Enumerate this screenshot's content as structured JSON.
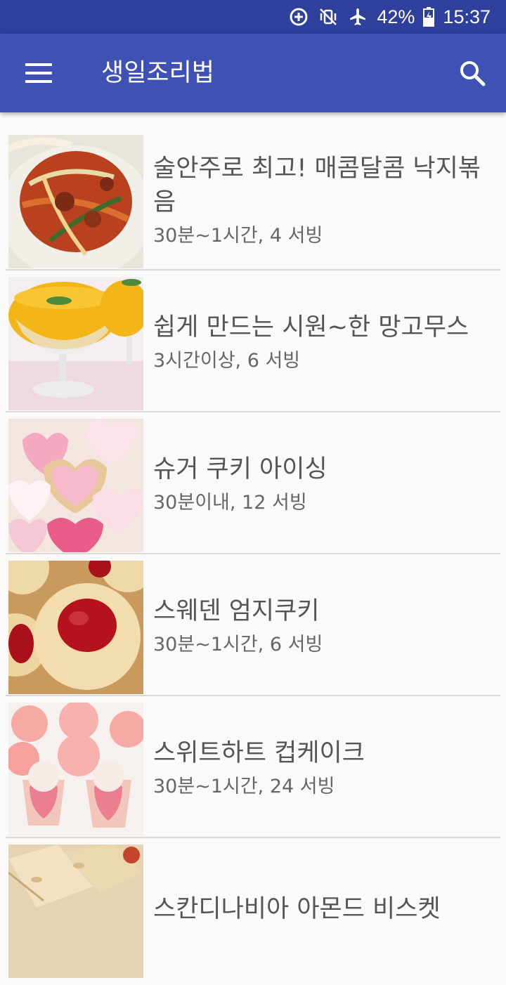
{
  "status_bar": {
    "icons": [
      "data-saver-icon",
      "vibrate-mute-icon",
      "airplane-icon",
      "battery-icon"
    ],
    "battery_percent": "42%",
    "time": "15:37"
  },
  "app_bar": {
    "title": "생일조리법",
    "menu_icon": "menu-icon",
    "search_icon": "search-icon",
    "color": "#3f51b5"
  },
  "recipes": [
    {
      "name": "술안주로 최고! 매콤달콤 낙지볶음",
      "meta": "30분~1시간, 4 서빙",
      "image": "spicy-octopus-stir-fry"
    },
    {
      "name": "쉽게 만드는 시원~한 망고무스",
      "meta": "3시간이상, 6 서빙",
      "image": "mango-mousse"
    },
    {
      "name": "슈거 쿠키 아이싱",
      "meta": "30분이내, 12 서빙",
      "image": "heart-sugar-cookies"
    },
    {
      "name": "스웨덴 엄지쿠키",
      "meta": "30분~1시간, 6 서빙",
      "image": "thumbprint-cookies"
    },
    {
      "name": "스위트하트 컵케이크",
      "meta": "30분~1시간, 24 서빙",
      "image": "sweetheart-cupcakes"
    },
    {
      "name": "스칸디나비아 아몬드 비스켓",
      "meta": "",
      "image": "almond-biscuits"
    }
  ]
}
